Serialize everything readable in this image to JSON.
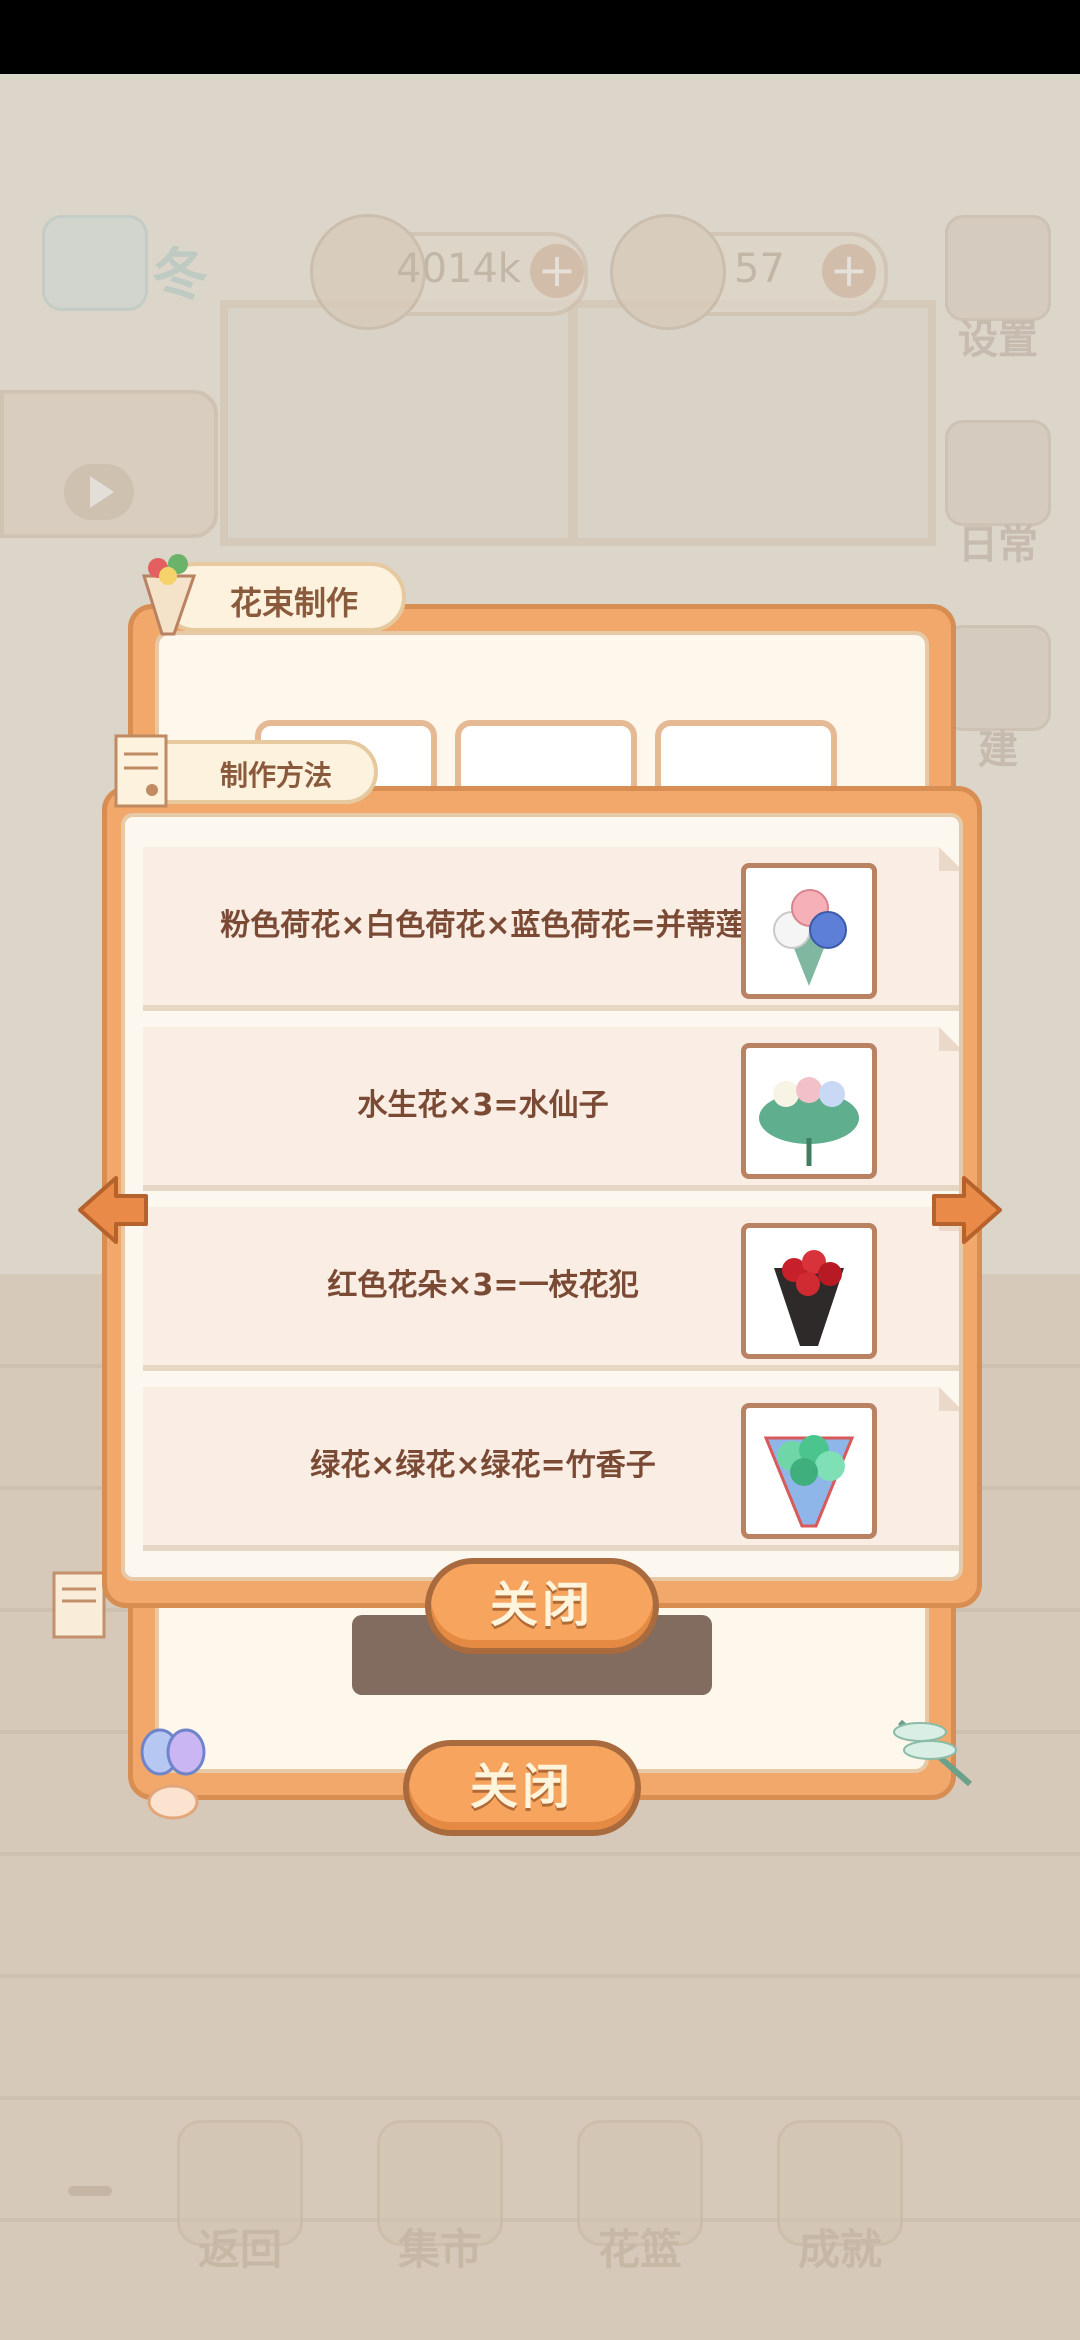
{
  "hud": {
    "season_label": "冬",
    "fish_bones": "4014k",
    "cheese": "57",
    "plus": "+"
  },
  "side_menu": [
    {
      "label": "设置",
      "icon": "gear-icon"
    },
    {
      "label": "日常",
      "icon": "daily-notes-icon"
    },
    {
      "label": "建",
      "icon": "build-icon"
    }
  ],
  "bouquet_panel": {
    "title": "花束制作",
    "close_label": "关闭"
  },
  "recipe_panel": {
    "title": "制作方法",
    "close_label": "关闭",
    "recipes": [
      {
        "formula": "粉色荷花×白色荷花×蓝色荷花=并蒂莲",
        "image": "lotus-bouquet-icon"
      },
      {
        "formula": "水生花×3=水仙子",
        "image": "aquatic-bouquet-icon"
      },
      {
        "formula": "红色花朵×3=一枝花犯",
        "image": "red-rose-bouquet-icon"
      },
      {
        "formula": "绿花×绿花×绿花=竹香子",
        "image": "green-bouquet-icon"
      }
    ]
  },
  "bottom_nav": [
    {
      "label": "返回",
      "icon": "door-icon"
    },
    {
      "label": "集市",
      "icon": "market-stall-icon"
    },
    {
      "label": "花篮",
      "icon": "flower-basket-icon"
    },
    {
      "label": "成就",
      "icon": "trophy-icon"
    }
  ],
  "colors": {
    "panel_orange": "#f2a86a",
    "panel_border": "#d88d52",
    "recipe_text": "#7a4a35",
    "button_text": "#fff4dc"
  }
}
